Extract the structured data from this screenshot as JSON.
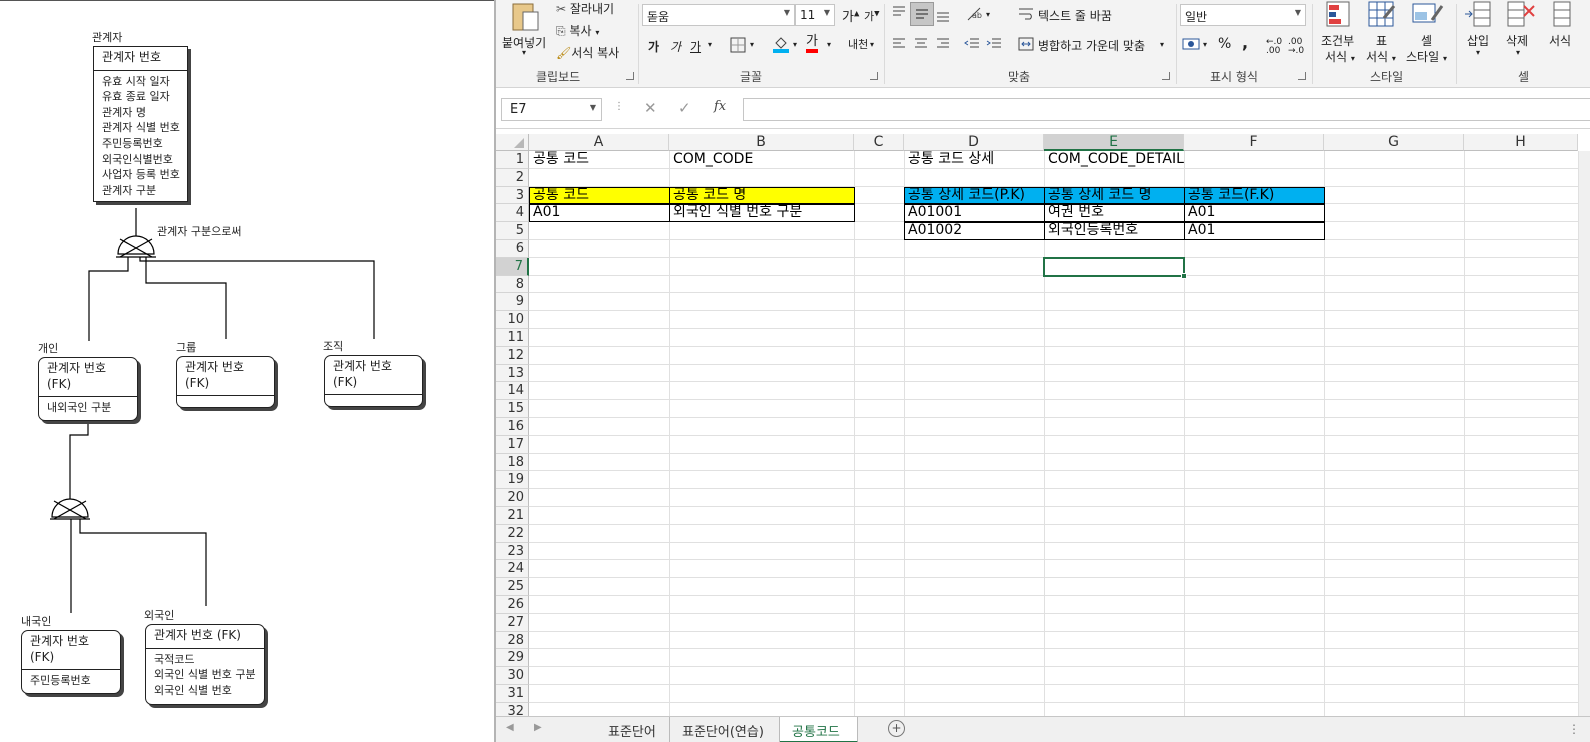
{
  "erd": {
    "parent": {
      "title": "관계자",
      "pk": "관계자 번호",
      "attrs": [
        "유효 시작 일자",
        "유효 종료 일자",
        "관계자 명",
        "관계자 식별 번호",
        "주민등록번호",
        "외국인식별번호",
        "사업자 등록 번호",
        "관계자 구분"
      ]
    },
    "subtype_label": "관계자 구분으로써",
    "individual": {
      "title": "개인",
      "pk": "관계자 번호 (FK)",
      "attrs": [
        "내외국인 구분"
      ]
    },
    "group": {
      "title": "그룹",
      "pk": "관계자 번호 (FK)"
    },
    "org": {
      "title": "조직",
      "pk": "관계자 번호 (FK)"
    },
    "domestic": {
      "title": "내국인",
      "pk": "관계자 번호 (FK)",
      "attrs": [
        "주민등록번호"
      ]
    },
    "foreign": {
      "title": "외국인",
      "pk": "관계자 번호 (FK)",
      "attrs": [
        "국적코드",
        "외국인 식별 번호 구분",
        "외국인 식별 번호"
      ]
    }
  },
  "ribbon": {
    "clipboard": {
      "paste": "붙여넣기",
      "cut": "잘라내기",
      "copy": "복사",
      "format_painter": "서식 복사",
      "label": "클립보드"
    },
    "font": {
      "name": "돋움",
      "size": "11",
      "bold": "가",
      "italic": "가",
      "underline": "가",
      "phonetic": "내천",
      "label": "글꼴"
    },
    "align": {
      "wrap": "텍스트 줄 바꿈",
      "merge": "병합하고 가운데 맞춤",
      "label": "맞춤"
    },
    "number": {
      "format": "일반",
      "percent": "%",
      "comma": ",",
      "label": "표시 형식"
    },
    "styles": {
      "cond_1": "조건부",
      "cond_2": "서식",
      "table_1": "표",
      "table_2": "서식",
      "cell_1": "셀",
      "cell_2": "스타일",
      "label": "스타일"
    },
    "cells": {
      "insert": "삽입",
      "delete": "삭제",
      "format": "서식",
      "label": "셀"
    }
  },
  "formula_bar": {
    "name_box": "E7",
    "fx": "fx",
    "formula": ""
  },
  "columns": [
    "A",
    "B",
    "C",
    "D",
    "E",
    "F",
    "G",
    "H"
  ],
  "selected_column": "E",
  "selected_row": 7,
  "rows": [
    1,
    2,
    3,
    4,
    5,
    6,
    7,
    8,
    9,
    10,
    11,
    12,
    13,
    14,
    15,
    16,
    17,
    18,
    19,
    20,
    21,
    22,
    23,
    24,
    25,
    26,
    27,
    28,
    29,
    30,
    31,
    32
  ],
  "cells": {
    "A1": "공통 코드",
    "B1": "COM_CODE",
    "D1": "공통 코드 상세",
    "E1": "COM_CODE_DETAIL",
    "A3": "공통 코드",
    "B3": "공통 코드 명",
    "A4": "A01",
    "B4": "외국인 식별 번호 구분",
    "D3": "공통 상세 코드(P.K)",
    "E3": "공통 상세 코드 명",
    "F3": "공통 코드(F.K)",
    "D4": "A01001",
    "E4": "여권 번호",
    "F4": "A01",
    "D5": "A01002",
    "E5": "외국인등록번호",
    "F5": "A01"
  },
  "colors": {
    "yellow": "#FFFF00",
    "blue": "#00B0F0",
    "excel_green": "#217346"
  },
  "sheet_tabs": [
    "표준단어",
    "표준단어(연습)",
    "공통코드"
  ],
  "active_tab": "공통코드"
}
